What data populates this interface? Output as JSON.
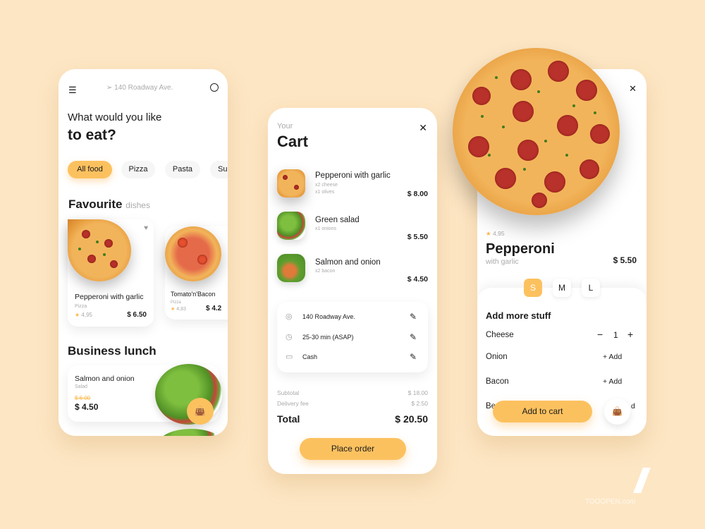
{
  "home": {
    "address": "140 Roadway Ave.",
    "heading_line1": "What would you like",
    "heading_line2": "to eat?",
    "categories": [
      "All food",
      "Pizza",
      "Pasta",
      "Sus"
    ],
    "favourite_title": "Favourite",
    "favourite_sub": "dishes",
    "favourites": [
      {
        "name": "Pepperoni with garlic",
        "category": "Pizza",
        "rating": "4,95",
        "price": "$ 6.50"
      },
      {
        "name": "Tomato'n'Bacon",
        "category": "Pizza",
        "rating": "4,83",
        "price": "$ 4.2"
      }
    ],
    "business_title": "Business lunch",
    "business": {
      "name": "Salmon and onion",
      "category": "Salad",
      "old_price": "$ 6.00",
      "price": "$ 4.50"
    }
  },
  "cart": {
    "subtitle": "Your",
    "title": "Cart",
    "items": [
      {
        "name": "Pepperoni with garlic",
        "extras": [
          "x2 cheese",
          "x1 olives"
        ],
        "price": "$ 8.00"
      },
      {
        "name": "Green salad",
        "extras": [
          "x1 onions"
        ],
        "price": "$ 5.50"
      },
      {
        "name": "Salmon and onion",
        "extras": [
          "x2 bacon"
        ],
        "price": "$ 4.50"
      }
    ],
    "address": "140 Roadway Ave.",
    "time": "25-30 min (ASAP)",
    "payment": "Cash",
    "subtotal_label": "Subtotal",
    "subtotal": "$ 18.00",
    "delivery_label": "Delivery fee",
    "delivery": "$ 2.50",
    "total_label": "Total",
    "total": "$ 20.50",
    "place_order": "Place order"
  },
  "detail": {
    "rating": "4,95",
    "name": "Pepperoni",
    "subtitle": "with garlic",
    "price": "$ 5.50",
    "sizes": [
      "S",
      "M",
      "L"
    ],
    "selected_size": "S",
    "extras_title": "Add more stuff",
    "extras": [
      {
        "name": "Cheese",
        "qty": "1"
      },
      {
        "name": "Onion",
        "action": "+ Add"
      },
      {
        "name": "Bacon",
        "action": "+ Add"
      },
      {
        "name": "Be",
        "action": "d"
      }
    ],
    "add_to_cart": "Add to cart"
  },
  "colors": {
    "accent": "#fcc15f",
    "background": "#fde6c4"
  },
  "watermark": "TOOOPEN.com"
}
